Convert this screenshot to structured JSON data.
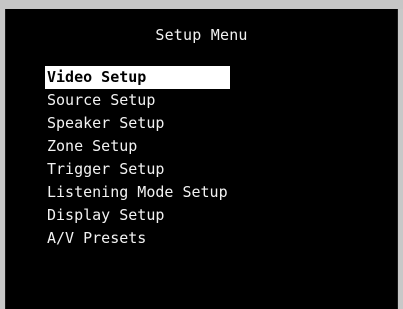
{
  "screen": {
    "title": "Setup Menu"
  },
  "menu": {
    "selected_index": 0,
    "items": [
      {
        "label": "Video Setup"
      },
      {
        "label": "Source Setup"
      },
      {
        "label": "Speaker Setup"
      },
      {
        "label": "Zone Setup"
      },
      {
        "label": "Trigger Setup"
      },
      {
        "label": "Listening Mode Setup"
      },
      {
        "label": "Display Setup"
      },
      {
        "label": "A/V Presets"
      }
    ]
  },
  "colors": {
    "screen_background": "#000000",
    "text": "#f2f2f2",
    "highlight_background": "#ffffff",
    "highlight_text": "#000000",
    "frame": "#c6c6c6"
  }
}
